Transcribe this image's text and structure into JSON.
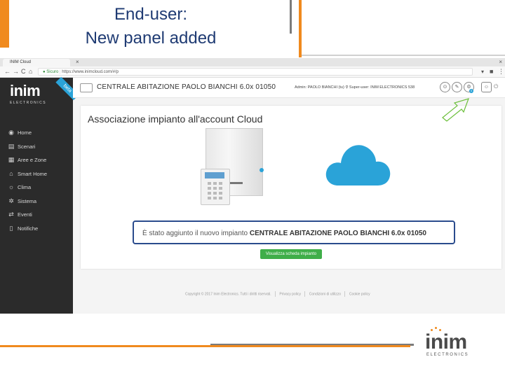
{
  "slide": {
    "title_line1": "End-user:",
    "title_line2": "New panel added"
  },
  "browser": {
    "tab_title": "INIM Cloud",
    "tab_close": "×",
    "back": "←",
    "forward": "→",
    "reload": "C",
    "home": "⌂",
    "secure_label": "Sicuro",
    "url": "https://www.inimcloud.com/#/p"
  },
  "sidebar": {
    "logo": "inim",
    "logo_sub": "ELECTRONICS",
    "ribbon": "beta",
    "items": [
      {
        "label": "Home",
        "icon": "dashboard-icon",
        "glyph": "◉"
      },
      {
        "label": "Scenari",
        "icon": "scenarios-icon",
        "glyph": "▤"
      },
      {
        "label": "Aree e Zone",
        "icon": "areas-icon",
        "glyph": "▦"
      },
      {
        "label": "Smart Home",
        "icon": "smart-home-icon",
        "glyph": "⌂"
      },
      {
        "label": "Clima",
        "icon": "thermometer-icon",
        "glyph": "☼"
      },
      {
        "label": "Sistema",
        "icon": "system-gears-icon",
        "glyph": "✲"
      },
      {
        "label": "Eventi",
        "icon": "events-icon",
        "glyph": "⇄"
      },
      {
        "label": "Notifiche",
        "icon": "phone-notifications-icon",
        "glyph": "▯"
      }
    ]
  },
  "header": {
    "panel_name": "CENTRALE ABITAZIONE PAOLO BIANCHI 6.0x 01050",
    "admin_info": "Admin: PAOLO BIANCHI (tu)",
    "super_user": "Super-user: INIM ELECTRONICS 538",
    "badge": "0"
  },
  "card": {
    "title": "Associazione impianto all'account Cloud",
    "message_prefix": "È stato aggiunto il nuovo impianto ",
    "message_bold": "CENTRALE ABITAZIONE PAOLO BIANCHI 6.0x 01050",
    "button": "Visualizza scheda impianto"
  },
  "footer": {
    "copyright": "Copyright © 2017 Inim Electronics. Tutti i diritti riservati.",
    "privacy": "Privacy policy",
    "conditions": "Condizioni di utilizzo",
    "cookie": "Cookie policy"
  },
  "brand": {
    "word": "inim",
    "sub": "ELECTRONICS"
  },
  "colors": {
    "accent_orange": "#f08a1e",
    "title_blue": "#1f3b73",
    "cloud_blue": "#2aa3d8",
    "sidebar_dark": "#2b2b2b",
    "button_green": "#3fae49",
    "highlight_border": "#2a4b8d"
  }
}
